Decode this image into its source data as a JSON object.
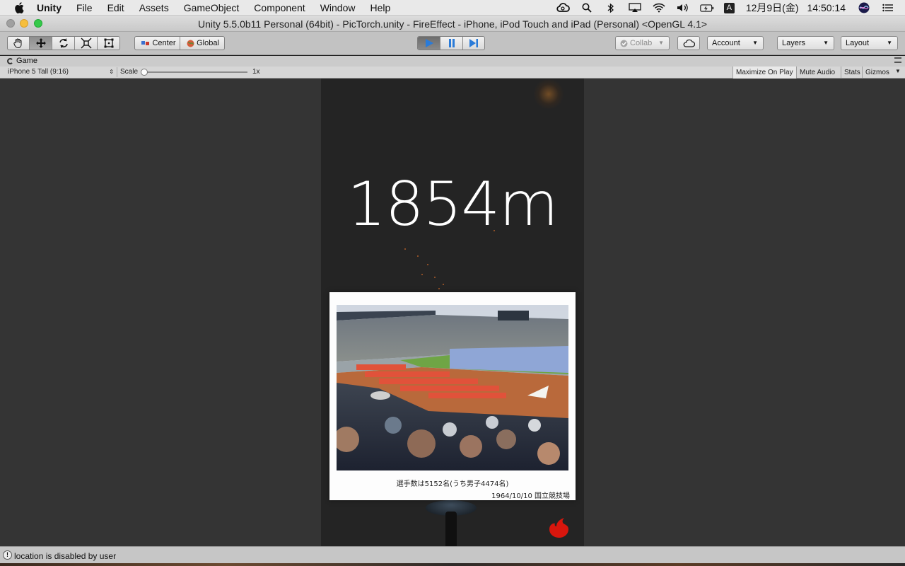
{
  "menubar": {
    "items": [
      "Unity",
      "File",
      "Edit",
      "Assets",
      "GameObject",
      "Component",
      "Window",
      "Help"
    ],
    "ime": "A",
    "date": "12月9日(金)",
    "time": "14:50:14"
  },
  "window": {
    "title": "Unity 5.5.0b11 Personal (64bit) - PicTorch.unity - FireEffect - iPhone, iPod Touch and iPad (Personal) <OpenGL 4.1>"
  },
  "toolbar": {
    "transform_tools": [
      "hand-icon",
      "move-icon",
      "rotate-icon",
      "scale-icon",
      "rect-icon"
    ],
    "pivot": "Center",
    "space": "Global",
    "playback": [
      "play-icon",
      "pause-icon",
      "step-icon"
    ],
    "collab": "Collab",
    "account": "Account",
    "layers": "Layers",
    "layout": "Layout",
    "play_color": "#2a7bd8"
  },
  "game_panel": {
    "tab": "Game",
    "aspect": "iPhone 5 Tall (9:16)",
    "scale_label": "Scale",
    "scale_value": "1x",
    "toggles": [
      "Maximize On Play",
      "Mute Audio",
      "Stats",
      "Gizmos"
    ]
  },
  "game": {
    "distance": "1854m",
    "caption_line1": "選手数は5152名(うち男子4474名)",
    "caption_line2": "1964/10/10  国立競技場",
    "fire_color": "#d8160d"
  },
  "status": {
    "message": "location is disabled by user"
  }
}
